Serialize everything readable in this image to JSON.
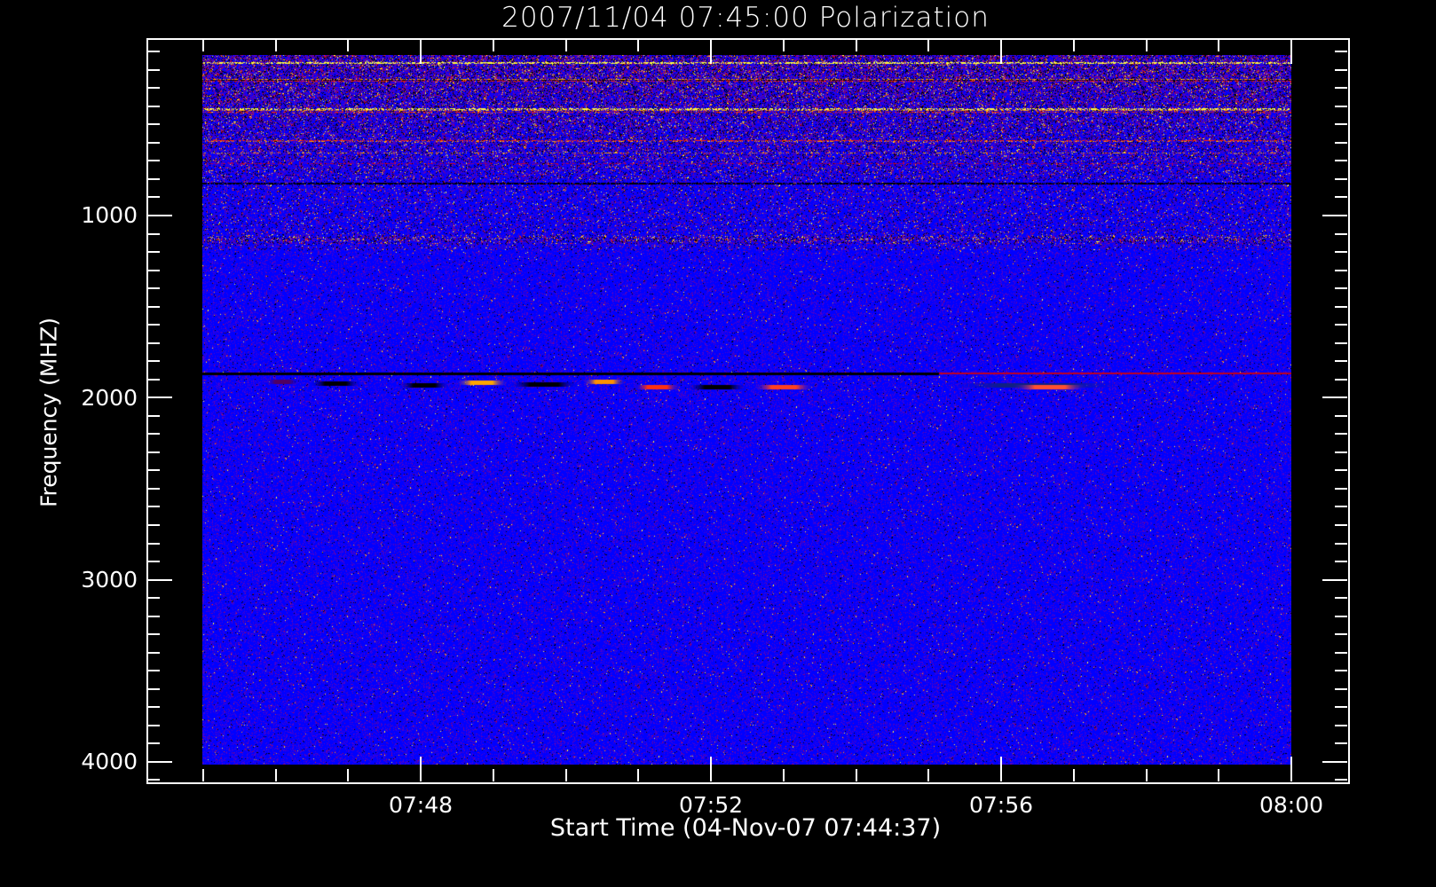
{
  "chart_data": {
    "type": "heatmap",
    "title": "2007/11/04 07:45:00 Polarization",
    "xlabel": "Start Time (04-Nov-07 07:44:37)",
    "ylabel": "Frequency (MHZ)",
    "x_ticks": [
      "07:48",
      "07:52",
      "07:56",
      "08:00"
    ],
    "x_tick_minutes": [
      48,
      52,
      56,
      60
    ],
    "x_minor_tick_step_minutes": 1,
    "x_range_minutes": [
      44.2,
      60.8
    ],
    "data_x_range_minutes": [
      45,
      60
    ],
    "y_ticks": [
      "1000",
      "2000",
      "3000",
      "4000"
    ],
    "y_tick_values": [
      1000,
      2000,
      3000,
      4000
    ],
    "y_minor_tick_step": 100,
    "y_range": [
      25,
      4110
    ],
    "y_inverted": true,
    "data_y_range": [
      115,
      4015
    ],
    "colormap": [
      "#000000",
      "#0000ff",
      "#800080",
      "#ff0000",
      "#ffa500",
      "#ffff00",
      "#ffffff"
    ],
    "features": [
      {
        "desc": "RFI band",
        "freq_mhz": [
          115,
          800
        ]
      },
      {
        "desc": "interference line",
        "freq_mhz": 1130
      },
      {
        "desc": "dark line",
        "freq_mhz": 1870
      },
      {
        "desc": "bursts",
        "freq_mhz": 1920
      }
    ],
    "grid": false
  }
}
